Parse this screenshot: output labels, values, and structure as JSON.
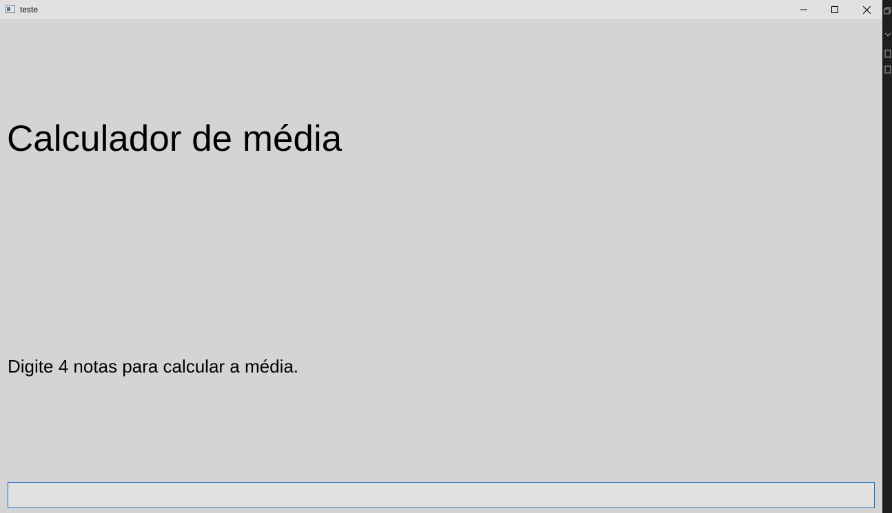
{
  "window": {
    "title": "teste",
    "app_icon": "window-app-icon",
    "controls": {
      "minimize_icon": "minimize-icon",
      "maximize_icon": "maximize-icon",
      "close_icon": "close-icon"
    }
  },
  "main": {
    "title": "Calculador de média",
    "instruction": "Digite 4 notas para calcular a média.",
    "input": {
      "value": "",
      "placeholder": ""
    }
  },
  "colors": {
    "window_background": "#d4d4d4",
    "titlebar_background": "#e1e1e1",
    "input_border_focus": "#1c6fc2",
    "input_background": "#e1e1e1",
    "text": "#000000",
    "background_app": "#1e1e1e"
  }
}
